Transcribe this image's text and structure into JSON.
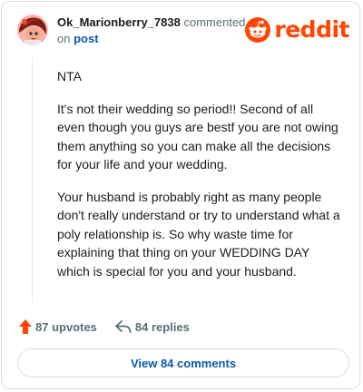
{
  "header": {
    "username": "Ok_Marionberry_7838",
    "action": "commented",
    "on_text": "on",
    "post_link": "post",
    "logo_text": "reddit"
  },
  "comment": {
    "paragraphs": [
      "NTA",
      "It's not their wedding so period!! Second of all even though you guys are bestf you are not owing them anything so you can make all the decisions for your life and your wedding.",
      "Your husband is probably right as many people don't really understand or try to understand what a poly relationship is. So why waste time for explaining that thing on your WEDDING DAY which is special for you and your husband."
    ]
  },
  "stats": {
    "upvotes": "87 upvotes",
    "replies": "84 replies"
  },
  "view_button": "View 84 comments",
  "colors": {
    "brand": "#ff4500",
    "link": "#0a5aa8",
    "muted": "#576f76",
    "border": "#d9dde1"
  }
}
